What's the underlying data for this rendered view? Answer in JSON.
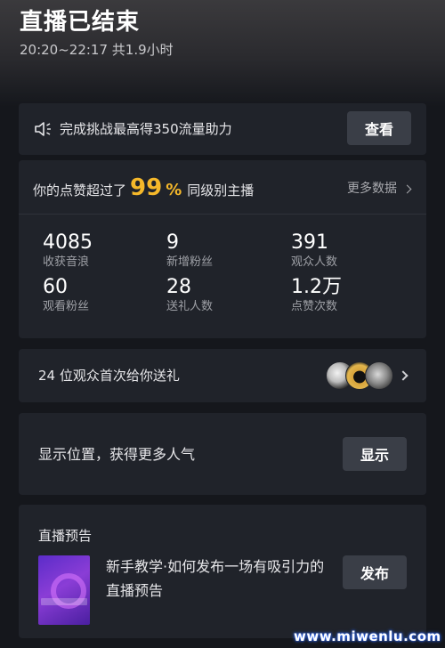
{
  "header": {
    "title": "直播已结束",
    "subtitle": "20:20~22:17 共1.9小时"
  },
  "challenge": {
    "text": "完成挑战最高得350流量助力",
    "button_label": "查看",
    "icon": "speaker-icon"
  },
  "stats": {
    "like_prefix": "你的点赞超过了",
    "like_percent": "99",
    "like_percent_sign": "%",
    "like_suffix": "同级别主播",
    "more_label": "更多数据",
    "items": [
      {
        "value": "4085",
        "label": "收获音浪"
      },
      {
        "value": "9",
        "label": "新增粉丝"
      },
      {
        "value": "391",
        "label": "观众人数"
      },
      {
        "value": "60",
        "label": "观看粉丝"
      },
      {
        "value": "28",
        "label": "送礼人数"
      },
      {
        "value": "1.2万",
        "label": "点赞次数"
      }
    ]
  },
  "gift": {
    "text": "24 位观众首次给你送礼"
  },
  "location": {
    "text": "显示位置，获得更多人气",
    "button_label": "显示"
  },
  "preview": {
    "title": "直播预告",
    "description": "新手教学·如何发布一场有吸引力的直播预告",
    "button_label": "发布"
  },
  "watermark": "www.miwenlu.com",
  "colors": {
    "accent": "#f5b82a",
    "card": "#20232a",
    "button": "#3a3e47"
  }
}
